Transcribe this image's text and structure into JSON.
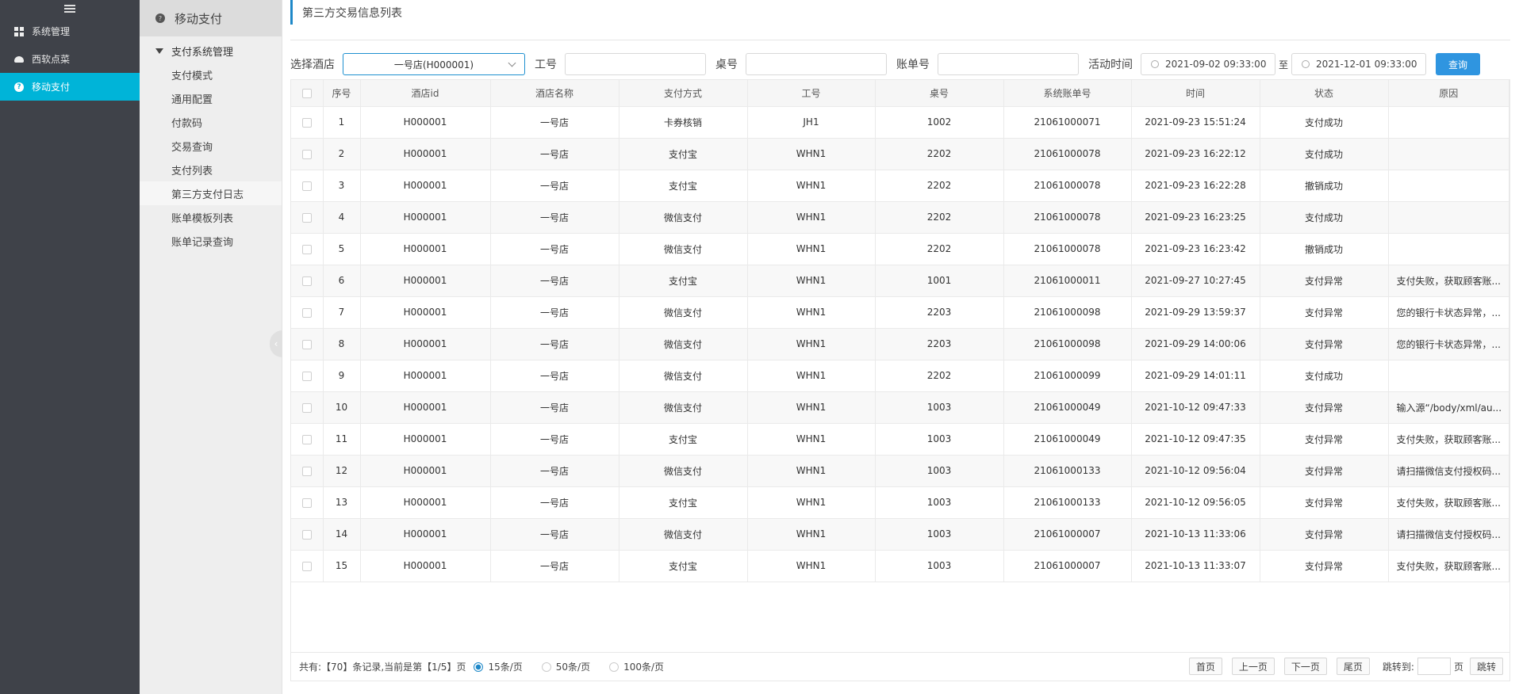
{
  "sidebar": {
    "items": [
      {
        "label": "系统管理",
        "icon": "grid-icon"
      },
      {
        "label": "西软点菜",
        "icon": "cloud-icon"
      },
      {
        "label": "移动支付",
        "icon": "payment-icon"
      }
    ]
  },
  "submenu": {
    "title": "移动支付",
    "group": "支付系统管理",
    "items": [
      "支付模式",
      "通用配置",
      "付款码",
      "交易查询",
      "支付列表",
      "第三方支付日志",
      "账单模板列表",
      "账单记录查询"
    ]
  },
  "page": {
    "title": "第三方交易信息列表"
  },
  "filters": {
    "hotel_label": "选择酒店",
    "hotel_value": "一号店(H000001)",
    "worker_label": "工号",
    "table_label": "桌号",
    "bill_label": "账单号",
    "time_label": "活动时间",
    "date_from": "2021-09-02 09:33:00",
    "to_label": "至",
    "date_to": "2021-12-01 09:33:00",
    "query_label": "查询"
  },
  "table": {
    "headers": [
      "序号",
      "酒店id",
      "酒店名称",
      "支付方式",
      "工号",
      "桌号",
      "系统账单号",
      "时间",
      "状态",
      "原因"
    ],
    "rows": [
      [
        "1",
        "H000001",
        "一号店",
        "卡券核销",
        "JH1",
        "1002",
        "21061000071",
        "2021-09-23 15:51:24",
        "支付成功",
        ""
      ],
      [
        "2",
        "H000001",
        "一号店",
        "支付宝",
        "WHN1",
        "2202",
        "21061000078",
        "2021-09-23 16:22:12",
        "支付成功",
        ""
      ],
      [
        "3",
        "H000001",
        "一号店",
        "支付宝",
        "WHN1",
        "2202",
        "21061000078",
        "2021-09-23 16:22:28",
        "撤销成功",
        ""
      ],
      [
        "4",
        "H000001",
        "一号店",
        "微信支付",
        "WHN1",
        "2202",
        "21061000078",
        "2021-09-23 16:23:25",
        "支付成功",
        ""
      ],
      [
        "5",
        "H000001",
        "一号店",
        "微信支付",
        "WHN1",
        "2202",
        "21061000078",
        "2021-09-23 16:23:42",
        "撤销成功",
        ""
      ],
      [
        "6",
        "H000001",
        "一号店",
        "支付宝",
        "WHN1",
        "1001",
        "21061000011",
        "2021-09-27 10:27:45",
        "支付异常",
        "支付失败，获取顾客账..."
      ],
      [
        "7",
        "H000001",
        "一号店",
        "微信支付",
        "WHN1",
        "2203",
        "21061000098",
        "2021-09-29 13:59:37",
        "支付异常",
        "您的银行卡状态异常，..."
      ],
      [
        "8",
        "H000001",
        "一号店",
        "微信支付",
        "WHN1",
        "2203",
        "21061000098",
        "2021-09-29 14:00:06",
        "支付异常",
        "您的银行卡状态异常，..."
      ],
      [
        "9",
        "H000001",
        "一号店",
        "微信支付",
        "WHN1",
        "2202",
        "21061000099",
        "2021-09-29 14:01:11",
        "支付成功",
        ""
      ],
      [
        "10",
        "H000001",
        "一号店",
        "微信支付",
        "WHN1",
        "1003",
        "21061000049",
        "2021-10-12 09:47:33",
        "支付异常",
        "输入源“/body/xml/au..."
      ],
      [
        "11",
        "H000001",
        "一号店",
        "支付宝",
        "WHN1",
        "1003",
        "21061000049",
        "2021-10-12 09:47:35",
        "支付异常",
        "支付失败，获取顾客账..."
      ],
      [
        "12",
        "H000001",
        "一号店",
        "微信支付",
        "WHN1",
        "1003",
        "21061000133",
        "2021-10-12 09:56:04",
        "支付异常",
        "请扫描微信支付授权码..."
      ],
      [
        "13",
        "H000001",
        "一号店",
        "支付宝",
        "WHN1",
        "1003",
        "21061000133",
        "2021-10-12 09:56:05",
        "支付异常",
        "支付失败，获取顾客账..."
      ],
      [
        "14",
        "H000001",
        "一号店",
        "微信支付",
        "WHN1",
        "1003",
        "21061000007",
        "2021-10-13 11:33:06",
        "支付异常",
        "请扫描微信支付授权码..."
      ],
      [
        "15",
        "H000001",
        "一号店",
        "支付宝",
        "WHN1",
        "1003",
        "21061000007",
        "2021-10-13 11:33:07",
        "支付异常",
        "支付失败，获取顾客账..."
      ]
    ]
  },
  "pager": {
    "summary": "共有:【70】条记录,当前是第【1/5】页",
    "size_options": [
      "15条/页",
      "50条/页",
      "100条/页"
    ],
    "first": "首页",
    "prev": "上一页",
    "next": "下一页",
    "last": "尾页",
    "jump_label": "跳转到:",
    "page_unit": "页",
    "jump_btn": "跳转"
  },
  "colors": {
    "accent": "#00b4d8",
    "primary": "#2f95e0",
    "sidebar_bg": "#3f4249"
  }
}
